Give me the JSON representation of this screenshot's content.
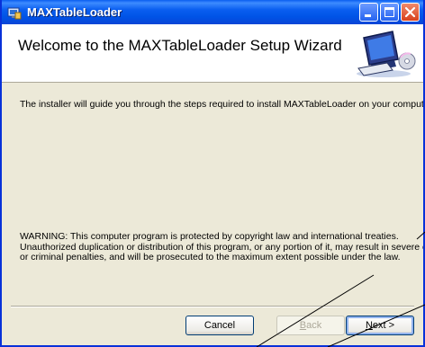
{
  "window": {
    "title": "MAXTableLoader",
    "icon": "installer-icon"
  },
  "header": {
    "title": "Welcome to the MAXTableLoader Setup Wizard",
    "art": "computer-cd-icon"
  },
  "body": {
    "intro": "The installer will guide you through the steps required to install MAXTableLoader on your computer.",
    "warning_lines": [
      "WARNING: This computer program is protected by copyright law and international treaties.",
      "Unauthorized duplication or distribution of this program, or any portion of it, may result in severe civil",
      "or criminal penalties, and will be prosecuted to the maximum extent possible under the law."
    ]
  },
  "buttons": {
    "cancel": "Cancel",
    "back_first": "B",
    "back_rest": "ack",
    "back_suffix": "",
    "next_first": "N",
    "next_rest": "ext",
    "next_suffix": " >"
  },
  "colors": {
    "titlebar": "#0a5ef0",
    "dialog_bg": "#ece9d8",
    "header_bg": "#ffffff"
  }
}
